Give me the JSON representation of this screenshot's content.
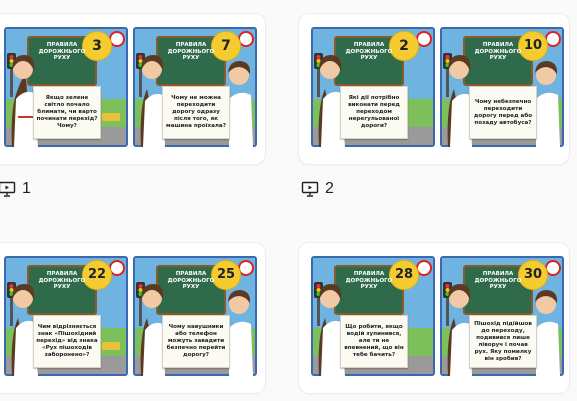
{
  "cards": [
    {
      "label": "1",
      "slides": [
        {
          "number": "3",
          "sign_title": "ПРАВИЛА ДОРОЖНЬОГО РУХУ",
          "question": "Якщо зелене світло почало блимати, чи варто починати перехід? Чому?"
        },
        {
          "number": "7",
          "sign_title": "ПРАВИЛА ДОРОЖНЬОГО РУХУ",
          "question": "Чому не можна переходити дорогу одразу після того, як машина проїхала?"
        }
      ]
    },
    {
      "label": "2",
      "slides": [
        {
          "number": "2",
          "sign_title": "ПРАВИЛА ДОРОЖНЬОГО РУХУ",
          "question": "Які дії потрібно виконати перед переходом нерегульованої дороги?"
        },
        {
          "number": "10",
          "sign_title": "ПРАВИЛА ДОРОЖНЬОГО РУХУ",
          "question": "Чому небезпечно переходити дорогу перед або позаду автобуса?"
        }
      ]
    },
    {
      "label": "",
      "slides": [
        {
          "number": "22",
          "sign_title": "ПРАВИЛА ДОРОЖНЬОГО РУХУ",
          "question": "Чим відрізняється знак «Пішохідний перехід» від знака «Рух пішоходів заборонено»?"
        },
        {
          "number": "25",
          "sign_title": "ПРАВИЛА ДОРОЖНЬОГО РУХУ",
          "question": "Чому навушники або телефон можуть завадити безпечно перейти дорогу?"
        }
      ]
    },
    {
      "label": "",
      "slides": [
        {
          "number": "28",
          "sign_title": "ПРАВИЛА ДОРОЖНЬОГО РУХУ",
          "question": "Що робити, якщо водій зупинився, але ти не впевнений, що він тебе бачить?"
        },
        {
          "number": "30",
          "sign_title": "ПРАВИЛА ДОРОЖНЬОГО РУХУ",
          "question": "Пішохід підійшов до переходу, подивився лише ліворуч і почав рух. Яку помилку він зробив?"
        }
      ]
    }
  ],
  "icons": {
    "presentation": "presentation-icon"
  },
  "colors": {
    "sky": "#6fb3e0",
    "board": "#2f6b4a",
    "badge": "#f4cc2f",
    "frame": "#3a69b0"
  }
}
